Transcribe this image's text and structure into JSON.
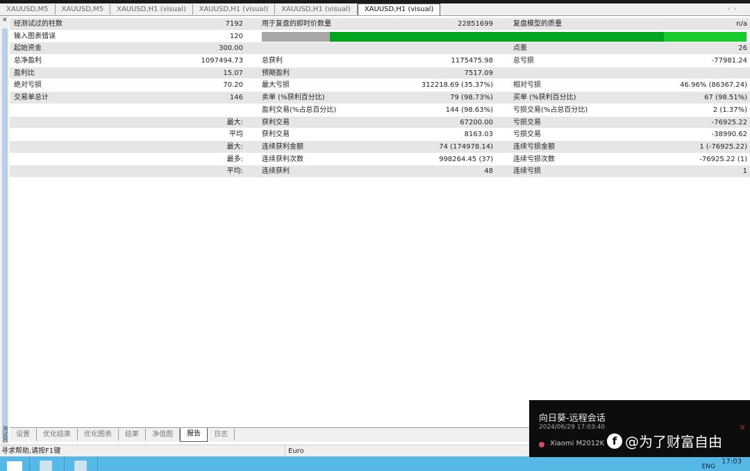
{
  "tabs": [
    "XAUUSD,M5",
    "XAUUSD,M5",
    "XAUUSD,H1 (visual)",
    "XAUUSD,H1 (visual)",
    "XAUUSD,H1 (visual)",
    "XAUUSD,H1 (visual)"
  ],
  "active_tab": 5,
  "report": {
    "rows": [
      [
        "经测试过的柱数",
        "7192",
        "用于复盘的即时价数量",
        "22851699",
        "复盘模型的质量",
        "n/a"
      ],
      [
        "输入图表错误",
        "120",
        "",
        "",
        "",
        ""
      ],
      [
        "起始资金",
        "300.00",
        "",
        "",
        "点差",
        "26"
      ],
      [
        "总净盈利",
        "1097494.73",
        "总获利",
        "1175475.98",
        "总亏损",
        "-77981.24"
      ],
      [
        "盈利比",
        "15.07",
        "预期盈利",
        "7517.09",
        "",
        ""
      ],
      [
        "绝对亏损",
        "70.20",
        "最大亏损",
        "312218.69 (35.37%)",
        "相对亏损",
        "46.96% (86367.24)"
      ],
      [
        "交易单总计",
        "146",
        "卖单 (%获利百分比)",
        "79 (98.73%)",
        "买单 (%获利百分比)",
        "67 (98.51%)"
      ],
      [
        "",
        "",
        "盈利交易(%占总百分比)",
        "144 (98.63%)",
        "亏损交易(%占总百分比)",
        "2 (1.37%)"
      ],
      [
        "",
        "最大:",
        "获利交易",
        "67200.00",
        "亏损交易",
        "-76925.22"
      ],
      [
        "",
        "平均",
        "获利交易",
        "8163.03",
        "亏损交易",
        "-38990.62"
      ],
      [
        "",
        "最大:",
        "连续获利金额",
        "74 (174978.14)",
        "连续亏损金额",
        "1 (-76925.22)"
      ],
      [
        "",
        "最多:",
        "连续获利次数",
        "998264.45 (37)",
        "连续亏损次数",
        "-76925.22 (1)"
      ],
      [
        "",
        "平均:",
        "连续获利",
        "48",
        "连续亏损",
        "1"
      ]
    ],
    "quality_bar": {
      "gray_pct": 14,
      "dark_green_pct": 69,
      "light_green_pct": 17
    }
  },
  "side_label": "测试器",
  "bottom_tabs": [
    "设置",
    "优化结果",
    "优化图表",
    "结果",
    "净值图",
    "报告",
    "日志"
  ],
  "active_bottom_tab": 5,
  "status": {
    "help": "寻求帮助,请按F1键",
    "profile": "Euro"
  },
  "notification": {
    "title": "向日葵-远程会话",
    "datetime": "2024/06/29 17:03:40",
    "device": "Xiaomi M2012K"
  },
  "watermark": "@为了财富自由",
  "tray": {
    "lang": "ENG",
    "time": "17:03"
  }
}
